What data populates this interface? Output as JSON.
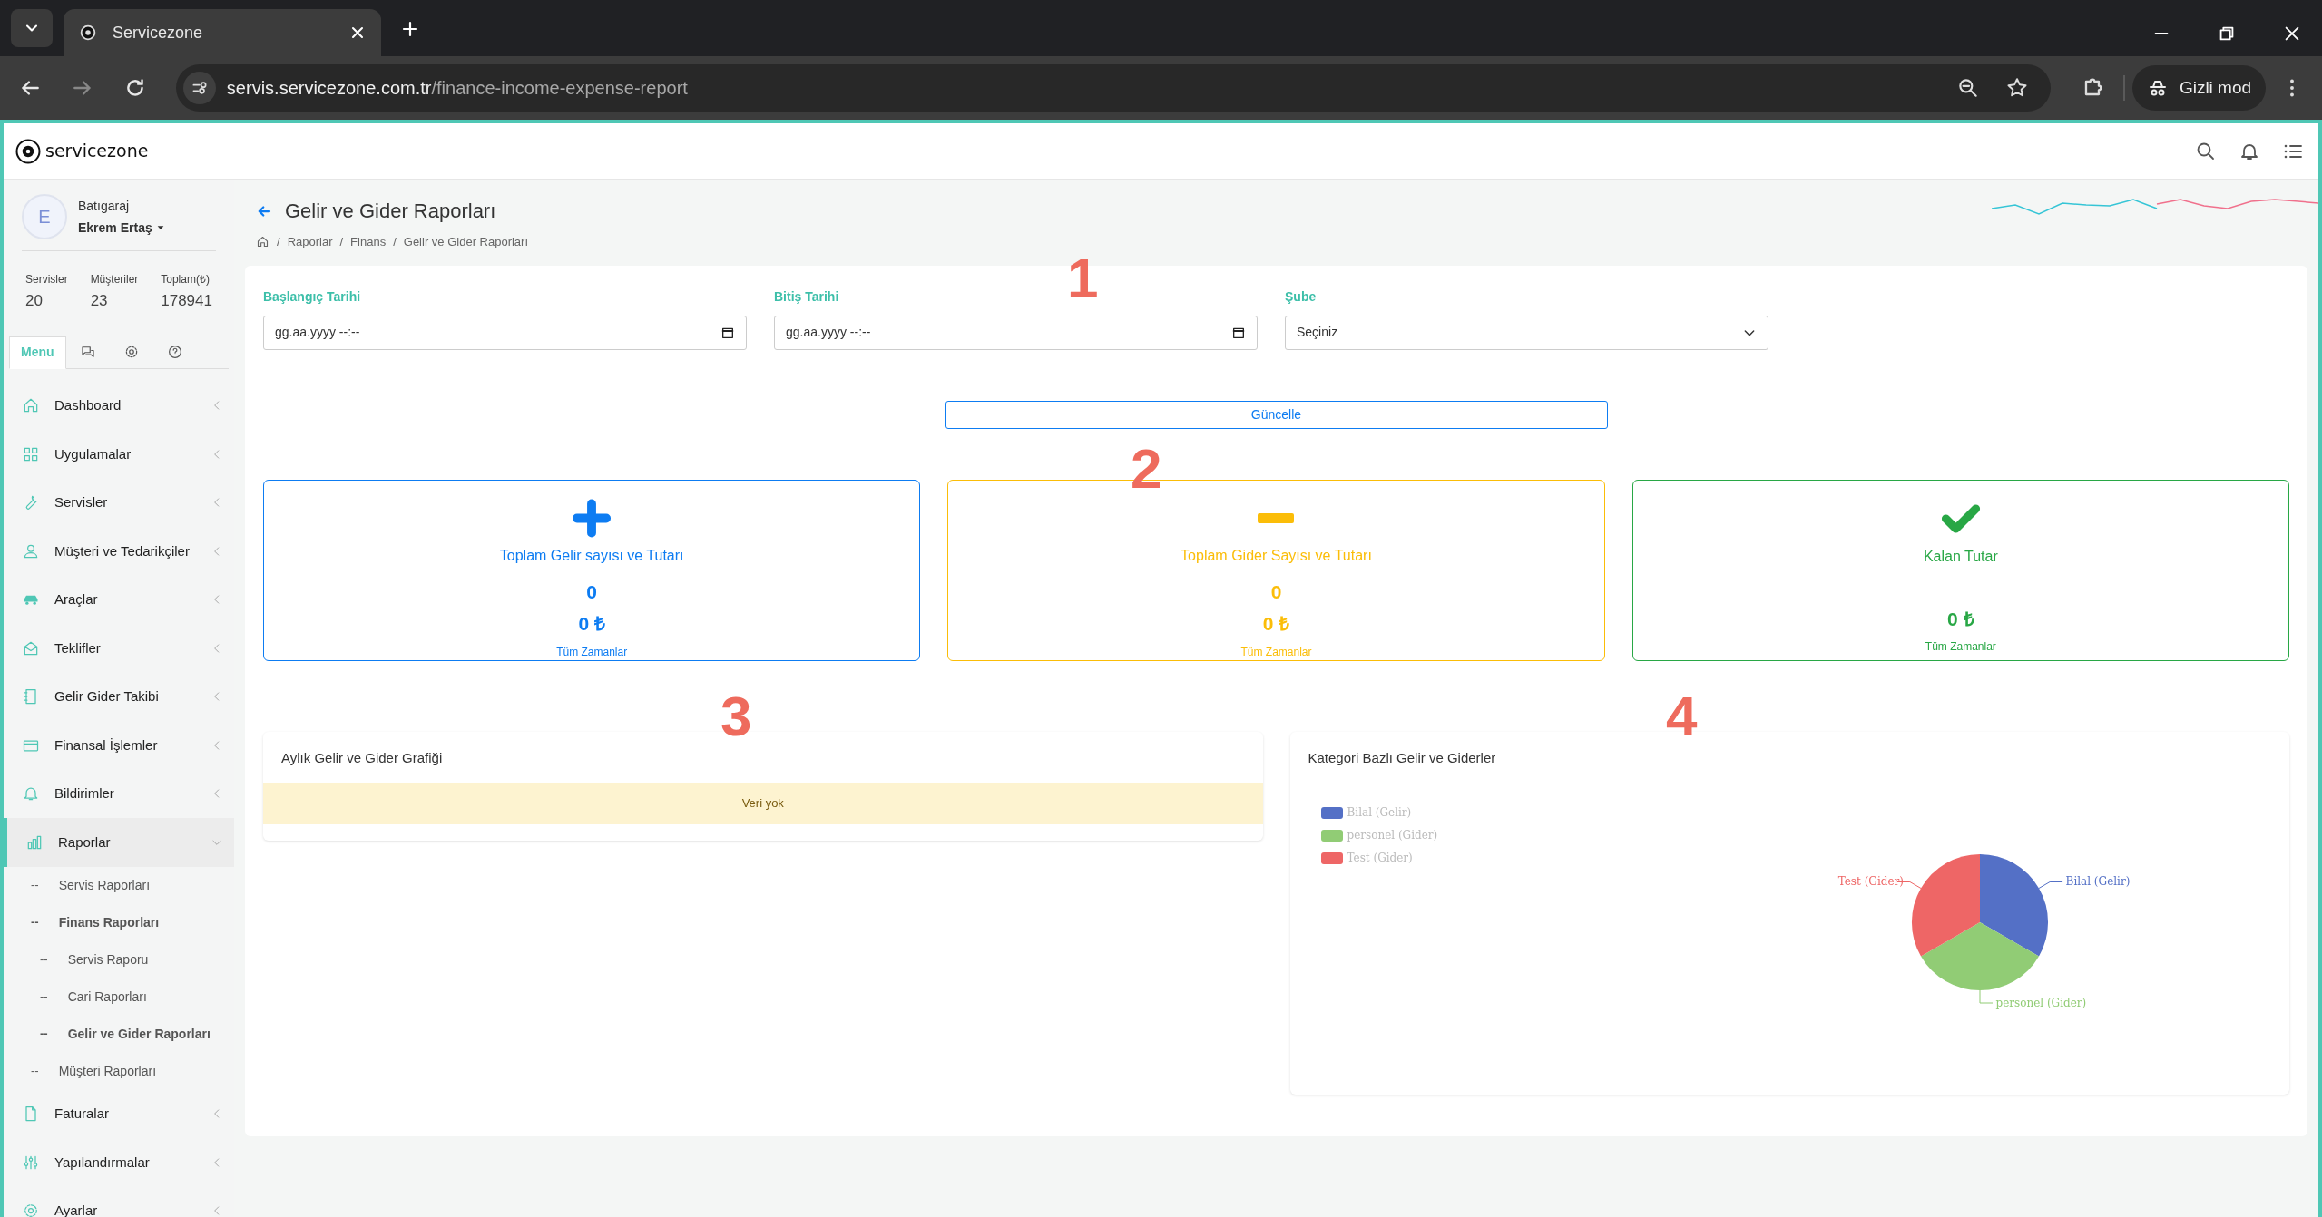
{
  "browser": {
    "tab_title": "Servicezone",
    "url_host": "servis.servicezone.com.tr",
    "url_path": "/finance-income-expense-report",
    "incognito_label": "Gizli mod"
  },
  "header": {
    "logo_text": "servicezone"
  },
  "sidebar": {
    "user": {
      "initial": "E",
      "company": "Batıgaraj",
      "name": "Ekrem Ertaş"
    },
    "stats": [
      {
        "label": "Servisler",
        "value": "20"
      },
      {
        "label": "Müşteriler",
        "value": "23"
      },
      {
        "label": "Toplam(₺)",
        "value": "178941"
      }
    ],
    "tabs": [
      {
        "kind": "text",
        "label": "Menu",
        "selected": true
      },
      {
        "kind": "chat",
        "selected": false
      },
      {
        "kind": "settings",
        "selected": false
      },
      {
        "kind": "help",
        "selected": false
      }
    ],
    "menu": [
      {
        "label": "Dashboard",
        "expanded": false
      },
      {
        "label": "Uygulamalar",
        "expanded": false
      },
      {
        "label": "Servisler",
        "expanded": false
      },
      {
        "label": "Müşteri ve Tedarikçiler",
        "expanded": false
      },
      {
        "label": "Araçlar",
        "expanded": false
      },
      {
        "label": "Teklifler",
        "expanded": false
      },
      {
        "label": "Gelir Gider Takibi",
        "expanded": false
      },
      {
        "label": "Finansal İşlemler",
        "expanded": false
      },
      {
        "label": "Bildirimler",
        "expanded": false
      },
      {
        "label": "Raporlar",
        "expanded": true,
        "children": [
          {
            "marker": "--",
            "label": "Servis Raporları",
            "active": false
          },
          {
            "marker": "--",
            "label": "Finans Raporları",
            "active": true,
            "children": [
              {
                "marker": "--",
                "label": "Servis Raporu",
                "active": false
              },
              {
                "marker": "--",
                "label": "Cari Raporları",
                "active": false
              },
              {
                "marker": "--",
                "label": "Gelir ve Gider Raporları",
                "active": true
              }
            ]
          },
          {
            "marker": "--",
            "label": "Müşteri Raporları",
            "active": false
          }
        ]
      },
      {
        "label": "Faturalar",
        "expanded": false
      },
      {
        "label": "Yapılandırmalar",
        "expanded": false
      },
      {
        "label": "Ayarlar",
        "expanded": false
      }
    ]
  },
  "page": {
    "title": "Gelir ve Gider Raporları",
    "breadcrumb": [
      {
        "separator": "/",
        "label": "Raporlar"
      },
      {
        "separator": "/",
        "label": "Finans"
      },
      {
        "separator": "/",
        "label": "Gelir ve Gider Raporları"
      }
    ],
    "filters": [
      {
        "kind": "date",
        "label": "Başlangıç Tarihi",
        "placeholder": "gg.aa.yyyy --:--"
      },
      {
        "kind": "date",
        "label": "Bitiş Tarihi",
        "placeholder": "gg.aa.yyyy --:--"
      },
      {
        "kind": "select",
        "label": "Şube",
        "value": "Seçiniz"
      }
    ],
    "update_button": "Güncelle",
    "stat_cards": [
      {
        "kind": "plus",
        "color": "#0d7cf2",
        "title": "Toplam Gelir sayısı ve Tutarı",
        "count": "0",
        "amount": "0 ₺",
        "period": "Tüm Zamanlar"
      },
      {
        "kind": "minus",
        "color": "#fbbd08",
        "title": "Toplam Gider Sayısı ve Tutarı",
        "count": "0",
        "amount": "0 ₺",
        "period": "Tüm Zamanlar"
      },
      {
        "kind": "check",
        "color": "#28a745",
        "title": "Kalan Tutar",
        "amount": "0 ₺",
        "period": "Tüm Zamanlar"
      }
    ],
    "monthly_chart": {
      "title": "Aylık Gelir ve Gider Grafiği",
      "empty_message": "Veri yok"
    },
    "category_chart": {
      "title": "Kategori Bazlı Gelir ve Giderler",
      "legend": [
        {
          "label": "Bilal (Gelir)",
          "color": "#5470c6"
        },
        {
          "label": "personel (Gider)",
          "color": "#91cc75"
        },
        {
          "label": "Test (Gider)",
          "color": "#ee6666"
        }
      ],
      "slice_labels": [
        "Bilal (Gelir)",
        "personel (Gider)",
        "Test (Gider)"
      ]
    }
  },
  "annotations": [
    "1",
    "2",
    "3",
    "4"
  ]
}
